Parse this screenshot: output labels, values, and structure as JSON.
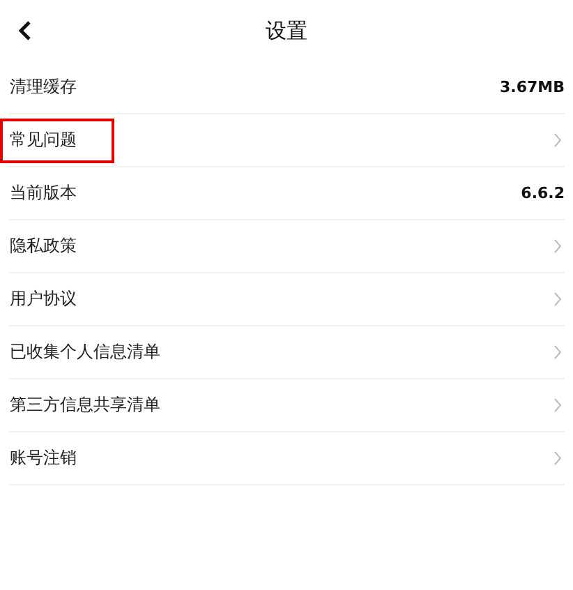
{
  "header": {
    "title": "设置"
  },
  "items": [
    {
      "label": "清理缓存",
      "kind": "value",
      "value": "3.67MB",
      "highlighted": false
    },
    {
      "label": "常见问题",
      "kind": "link",
      "highlighted": true
    },
    {
      "label": "当前版本",
      "kind": "value",
      "value": "6.6.2",
      "highlighted": false
    },
    {
      "label": "隐私政策",
      "kind": "link",
      "highlighted": false
    },
    {
      "label": "用户协议",
      "kind": "link",
      "highlighted": false
    },
    {
      "label": "已收集个人信息清单",
      "kind": "link",
      "highlighted": false
    },
    {
      "label": "第三方信息共享清单",
      "kind": "link",
      "highlighted": false
    },
    {
      "label": "账号注销",
      "kind": "link",
      "highlighted": false
    }
  ]
}
